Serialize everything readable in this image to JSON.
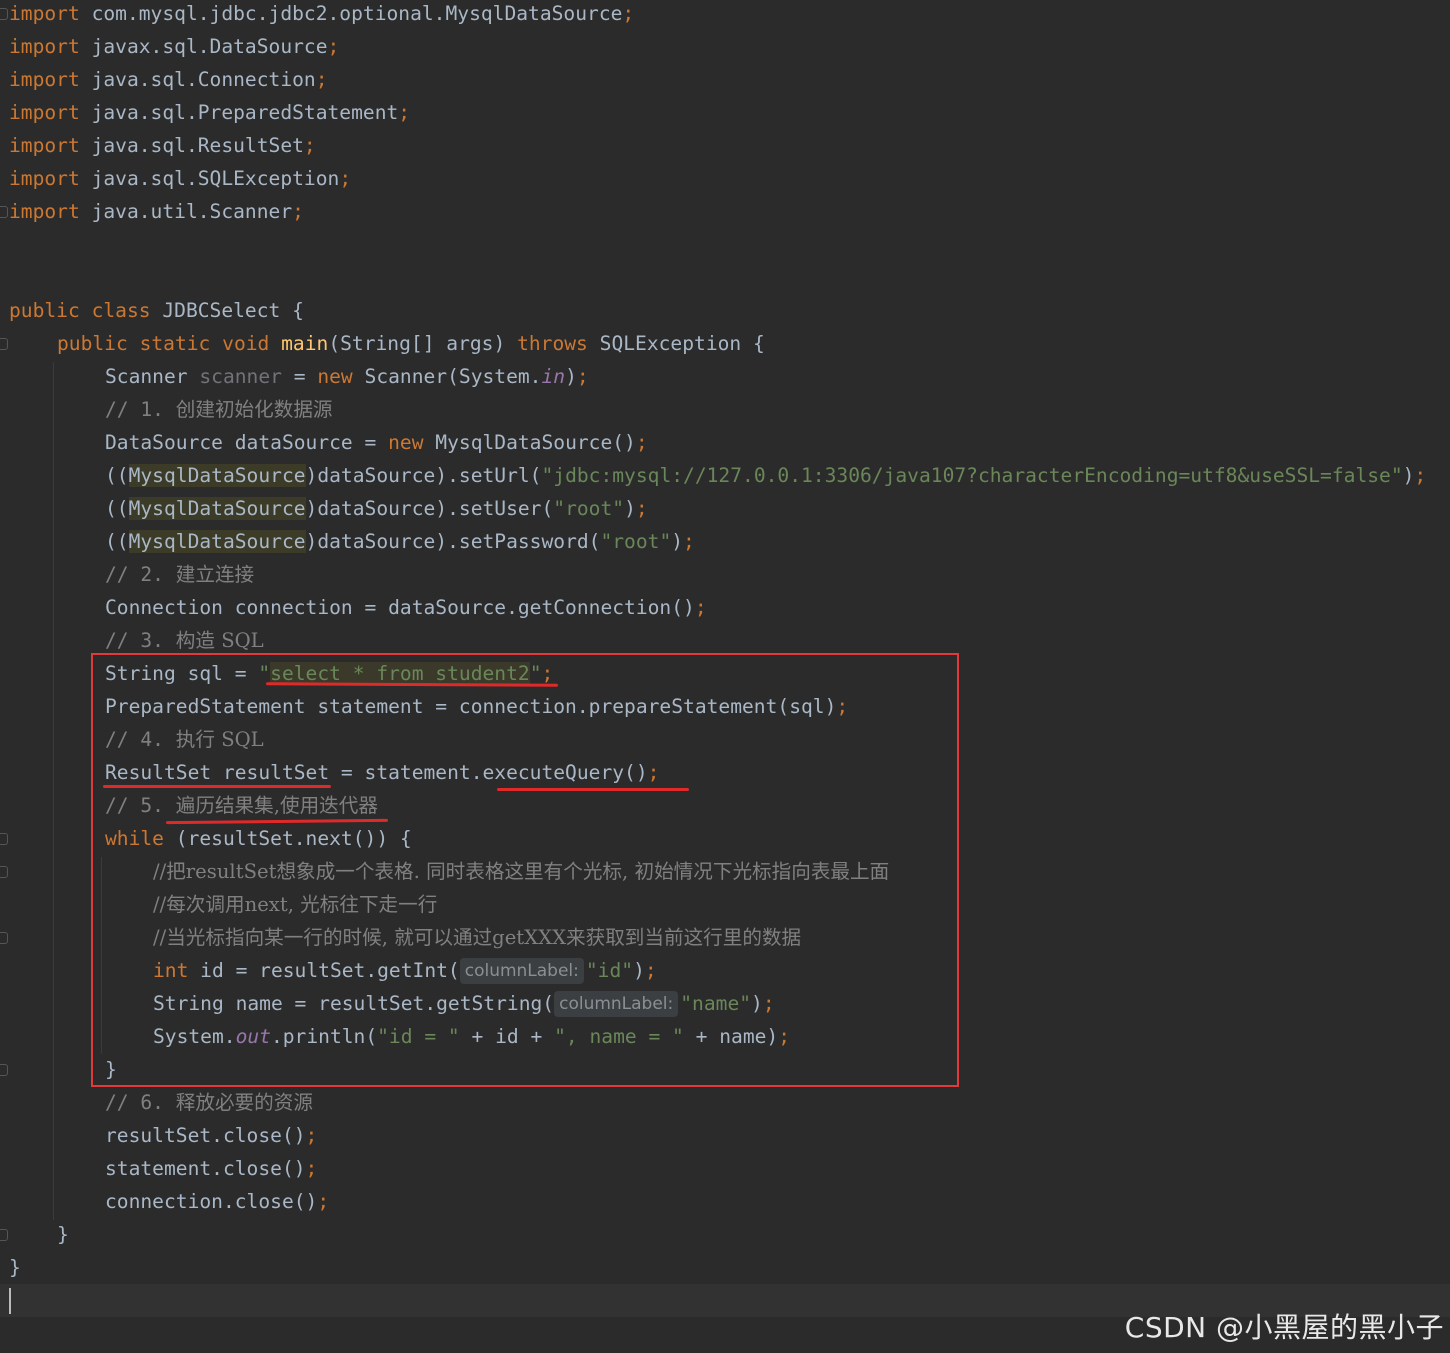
{
  "code_lines": {
    "l1": {
      "kw": "import",
      "rest": " com.mysql.jdbc.jdbc2.optional.MysqlDataSource",
      "semi": ";"
    },
    "l2": {
      "kw": "import",
      "rest": " javax.sql.DataSource",
      "semi": ";"
    },
    "l3": {
      "kw": "import",
      "rest": " java.sql.Connection",
      "semi": ";"
    },
    "l4": {
      "kw": "import",
      "rest": " java.sql.PreparedStatement",
      "semi": ";"
    },
    "l5": {
      "kw": "import",
      "rest": " java.sql.ResultSet",
      "semi": ";"
    },
    "l6": {
      "kw": "import",
      "rest": " java.sql.SQLException",
      "semi": ";"
    },
    "l7": {
      "kw": "import",
      "rest": " java.util.Scanner",
      "semi": ";"
    },
    "l10": {
      "kw1": "public",
      "kw2": "class",
      "rest": " JDBCSelect {"
    },
    "l11": {
      "kw1": "public",
      "kw2": "static",
      "kw3": "void",
      "fn": "main",
      "mid": "(String[] args) ",
      "kw4": "throws",
      "rest": " SQLException {"
    },
    "l12": {
      "a": "Scanner ",
      "dim": "scanner",
      "b": " = ",
      "kw": "new",
      "c": " Scanner(System.",
      "stat": "in",
      "d": ")",
      "semi": ";"
    },
    "l13": {
      "cmt_prefix": "// 1. ",
      "cmt": "创建初始化数据源"
    },
    "l14": {
      "a": "DataSource dataSource = ",
      "kw": "new",
      "b": " MysqlDataSource()",
      "semi": ";"
    },
    "l15": {
      "a": "((",
      "cast": "MysqlDataSource",
      "b": ")dataSource).setUrl(",
      "str": "\"jdbc:mysql://127.0.0.1:3306/java107?characterEncoding=utf8&useSSL=false\"",
      "c": ")",
      "semi": ";"
    },
    "l16": {
      "a": "((",
      "cast": "MysqlDataSource",
      "b": ")dataSource).setUser(",
      "str": "\"root\"",
      "c": ")",
      "semi": ";"
    },
    "l17": {
      "a": "((",
      "cast": "MysqlDataSource",
      "b": ")dataSource).setPassword(",
      "str": "\"root\"",
      "c": ")",
      "semi": ";"
    },
    "l18": {
      "cmt_prefix": "// 2. ",
      "cmt": "建立连接"
    },
    "l19": {
      "a": "Connection connection = dataSource.getConnection()",
      "semi": ";"
    },
    "l20": {
      "cmt_prefix": "// 3. ",
      "cmt": "构造 SQL"
    },
    "l21": {
      "a": "String sql = ",
      "q1": "\"",
      "sql": "select * from student2",
      "q2": "\"",
      "semi": ";"
    },
    "l22": {
      "a": "PreparedStatement statement = connection.prepareStatement(sql)",
      "semi": ";"
    },
    "l23": {
      "cmt_prefix": "// 4. ",
      "cmt": "执行 SQL"
    },
    "l24": {
      "a": "ResultSet resultSet = statement.executeQuery()",
      "semi": ";"
    },
    "l25": {
      "cmt_prefix": "// 5. ",
      "cmt": "遍历结果集,使用迭代器"
    },
    "l26": {
      "kw": "while",
      "rest": " (resultSet.next()) {"
    },
    "l27": {
      "cmt": "//把resultSet想象成一个表格. 同时表格这里有个光标, 初始情况下光标指向表最上面"
    },
    "l28": {
      "cmt": "//每次调用next, 光标往下走一行"
    },
    "l29": {
      "cmt": "//当光标指向某一行的时候, 就可以通过getXXX来获取到当前这行里的数据"
    },
    "l30": {
      "kw": "int",
      "a": " id = resultSet.getInt(",
      "hint": "columnLabel:",
      "str": "\"id\"",
      "b": ")",
      "semi": ";"
    },
    "l31": {
      "a": "String name = resultSet.getString(",
      "hint": "columnLabel:",
      "str": "\"name\"",
      "b": ")",
      "semi": ";"
    },
    "l32": {
      "a": "System.",
      "stat": "out",
      "b": ".println(",
      "str1": "\"id = \"",
      "c": " + id + ",
      "str2": "\", name = \"",
      "d": " + name)",
      "semi": ";"
    },
    "l33": {
      "a": "}"
    },
    "l34": {
      "cmt_prefix": "// 6. ",
      "cmt": "释放必要的资源"
    },
    "l35": {
      "a": "resultSet.close()",
      "semi": ";"
    },
    "l36": {
      "a": "statement.close()",
      "semi": ";"
    },
    "l37": {
      "a": "connection.close()",
      "semi": ";"
    },
    "l38": {
      "a": "}"
    },
    "l39": {
      "a": "}"
    }
  },
  "colors": {
    "background": "#2b2b2b",
    "keyword": "#cc7832",
    "string": "#6a8759",
    "comment": "#808080",
    "method_declaration": "#ffc66d",
    "static_field": "#9876aa",
    "annotation_red": "#e03a3a"
  },
  "watermark": "CSDN @小黑屋的黑小子"
}
